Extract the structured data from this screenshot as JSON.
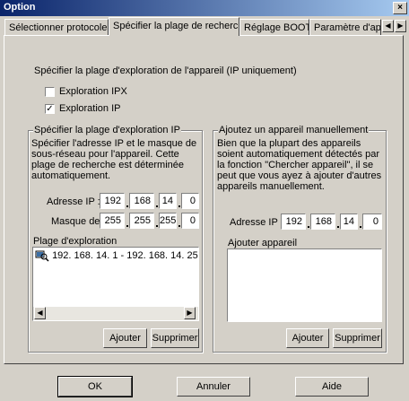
{
  "window": {
    "title": "Option",
    "close_glyph": "×"
  },
  "tabs": [
    {
      "label": "Sélectionner protocole"
    },
    {
      "label": "Spécifier la plage de recherche"
    },
    {
      "label": "Réglage BOOTP"
    },
    {
      "label": "Paramètre d'appe"
    }
  ],
  "tab_scroll": {
    "left": "◀",
    "right": "▶"
  },
  "main": {
    "intro": "Spécifier la plage d'exploration de l'appareil (IP uniquement)",
    "ipx": {
      "label": "Exploration IPX",
      "checked": false
    },
    "ip": {
      "label": "Exploration IP",
      "checked": true,
      "mark": "✓"
    }
  },
  "left_group": {
    "title": "Spécifier la plage d'exploration IP",
    "description": "Spécifier l'adresse IP et le masque de sous-réseau pour l'appareil. Cette plage de recherche est déterminée automatiquement.",
    "ip_label": "Adresse IP :",
    "ip": [
      "192",
      "168",
      "14",
      "0"
    ],
    "mask_label": "Masque de",
    "mask": [
      "255",
      "255",
      "255",
      "0"
    ],
    "range_label": "Plage d'exploration",
    "range_items": [
      "192. 168.  14.   1 - 192. 168.  14. 25"
    ],
    "scroll_left": "◀",
    "scroll_right": "▶",
    "add": "Ajouter",
    "delete": "Supprimer"
  },
  "right_group": {
    "title": "Ajoutez un appareil manuellement",
    "description": "Bien que la plupart des appareils soient automatiquement détectés par la fonction \"Chercher appareil\", il se peut que vous ayez à ajouter d'autres appareils manuellement.",
    "ip_label": "Adresse IP :",
    "ip": [
      "192",
      "168",
      "14",
      "0"
    ],
    "add_label": "Ajouter appareil",
    "add": "Ajouter",
    "delete": "Supprimer"
  },
  "footer": {
    "ok": "OK",
    "cancel": "Annuler",
    "help": "Aide"
  }
}
